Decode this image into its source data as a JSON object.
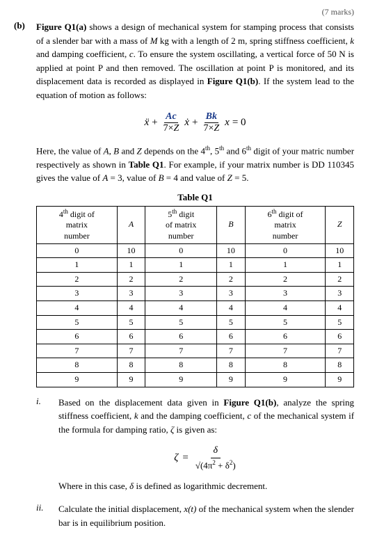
{
  "top_right": "(7 marks)",
  "part_b": {
    "label": "(b)",
    "intro": "Figure Q1(a) shows a design of mechanical system for stamping process that consists of a slender bar with a mass of M kg with a length of 2 m, spring stiffness coefficient, k and damping coefficient, c. To ensure the system oscillating, a vertical force of 50 N is applied at point P and then removed. The oscillation at point P is monitored, and its displacement data is recorded as displayed in Figure Q1(b). If the system lead to the equation of motion as follows:"
  },
  "equation": {
    "main": "ẍ + (Ac / 7×Z) ẋ + (Bk / 7×Z) x = 0"
  },
  "here_text": "Here, the value of A, B and Z depends on the 4th, 5th and 6th digit of your matric number respectively as shown in Table Q1. For example, if your matrix number is DD 110345 gives the value of A = 3, value of B = 4 and value of Z = 5.",
  "table": {
    "title": "Table Q1",
    "headers": [
      "4th digit of matrix number",
      "A",
      "5th digit of matrix number",
      "B",
      "6th digit of matrix number",
      "Z"
    ],
    "rows": [
      [
        "0",
        "10",
        "0",
        "10",
        "0",
        "10"
      ],
      [
        "1",
        "1",
        "1",
        "1",
        "1",
        "1"
      ],
      [
        "2",
        "2",
        "2",
        "2",
        "2",
        "2"
      ],
      [
        "3",
        "3",
        "3",
        "3",
        "3",
        "3"
      ],
      [
        "4",
        "4",
        "4",
        "4",
        "4",
        "4"
      ],
      [
        "5",
        "5",
        "5",
        "5",
        "5",
        "5"
      ],
      [
        "6",
        "6",
        "6",
        "6",
        "6",
        "6"
      ],
      [
        "7",
        "7",
        "7",
        "7",
        "7",
        "7"
      ],
      [
        "8",
        "8",
        "8",
        "8",
        "8",
        "8"
      ],
      [
        "9",
        "9",
        "9",
        "9",
        "9",
        "9"
      ]
    ]
  },
  "sub_items": [
    {
      "label": "i.",
      "text": "Based on the displacement data given in Figure Q1(b), analyze the spring stiffness coefficient, k and the damping coefficient, c of the mechanical system if the formula for damping ratio, ζ is given as:",
      "formula_desc": "ζ = δ / √(4π² + δ²)",
      "note": "Where in this case, δ is defined as logarithmic decrement."
    },
    {
      "label": "ii.",
      "text": "Calculate the initial displacement, x(t) of the mechanical system when the slender bar is in equilibrium position."
    }
  ]
}
